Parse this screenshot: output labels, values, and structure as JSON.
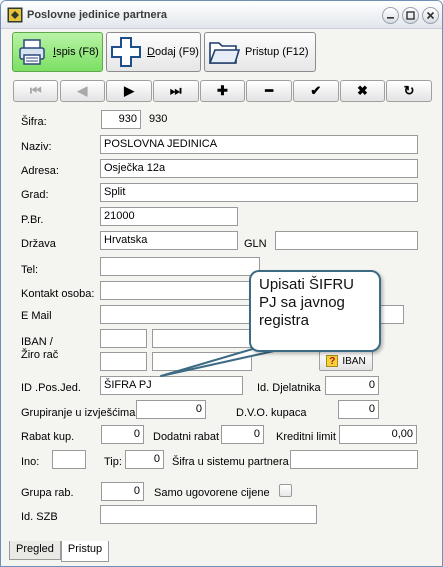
{
  "window": {
    "title": "Poslovne jedinice partnera"
  },
  "toolbar": {
    "print": {
      "label_key": "I",
      "label_rest": "spis (F8)"
    },
    "add": {
      "label_key": "D",
      "label_rest": "odaj (F9)"
    },
    "access": {
      "label": "Pristup (F12)"
    }
  },
  "nav": [
    "first",
    "prev",
    "next",
    "last",
    "add",
    "delete",
    "confirm",
    "cancel",
    "refresh"
  ],
  "form": {
    "sifra": {
      "label": "Šifra:",
      "value": "930",
      "display": "930"
    },
    "naziv": {
      "label": "Naziv:",
      "value": "POSLOVNA JEDINICA"
    },
    "adresa": {
      "label": "Adresa:",
      "value": "Osječka 12a"
    },
    "grad": {
      "label": "Grad:",
      "value": "Split"
    },
    "pbr": {
      "label": "P.Br.",
      "value": "21000"
    },
    "drzava": {
      "label": "Država",
      "value": "Hrvatska"
    },
    "gln": {
      "label": "GLN",
      "value": ""
    },
    "tel": {
      "label": "Tel:",
      "value": ""
    },
    "kontakt": {
      "label": "Kontakt osoba:",
      "value": ""
    },
    "email": {
      "label": "E Mail",
      "value": ""
    },
    "iban": {
      "label1": "IBAN /",
      "label2": "Žiro rač",
      "button": "IBAN"
    },
    "id_pos_jed": {
      "label": "ID .Pos.Jed.",
      "value": "ŠIFRA PJ"
    },
    "id_djelatnika": {
      "label": "Id. Djelatnika",
      "value": "0"
    },
    "grupiranje": {
      "label": "Grupiranje u izvješćima",
      "value": "0"
    },
    "dvo_kupaca": {
      "label": "D.V.O. kupaca",
      "value": "0"
    },
    "rabat_kup": {
      "label": "Rabat kup.",
      "value": "0"
    },
    "dodatni_rabat": {
      "label": "Dodatni rabat",
      "value": "0"
    },
    "kreditni_limit": {
      "label": "Kreditni limit",
      "value": "0,00"
    },
    "ino": {
      "label": "Ino:",
      "value": ""
    },
    "tip": {
      "label": "Tip:",
      "value": "0"
    },
    "sifra_sustav": {
      "label": "Šifra u sistemu partnera",
      "value": ""
    },
    "grupa_rab": {
      "label": "Grupa rab.",
      "value": "0"
    },
    "samo_ugovorene": {
      "label": "Samo ugovorene cijene",
      "checked": false
    },
    "id_szb": {
      "label": "Id. SZB",
      "value": ""
    }
  },
  "tooltip": {
    "line1": "Upisati ŠIFRU",
    "line2": "PJ sa javnog",
    "line3": "registra"
  },
  "tabs": [
    {
      "label": "Pregled"
    },
    {
      "label": "Pristup"
    }
  ]
}
